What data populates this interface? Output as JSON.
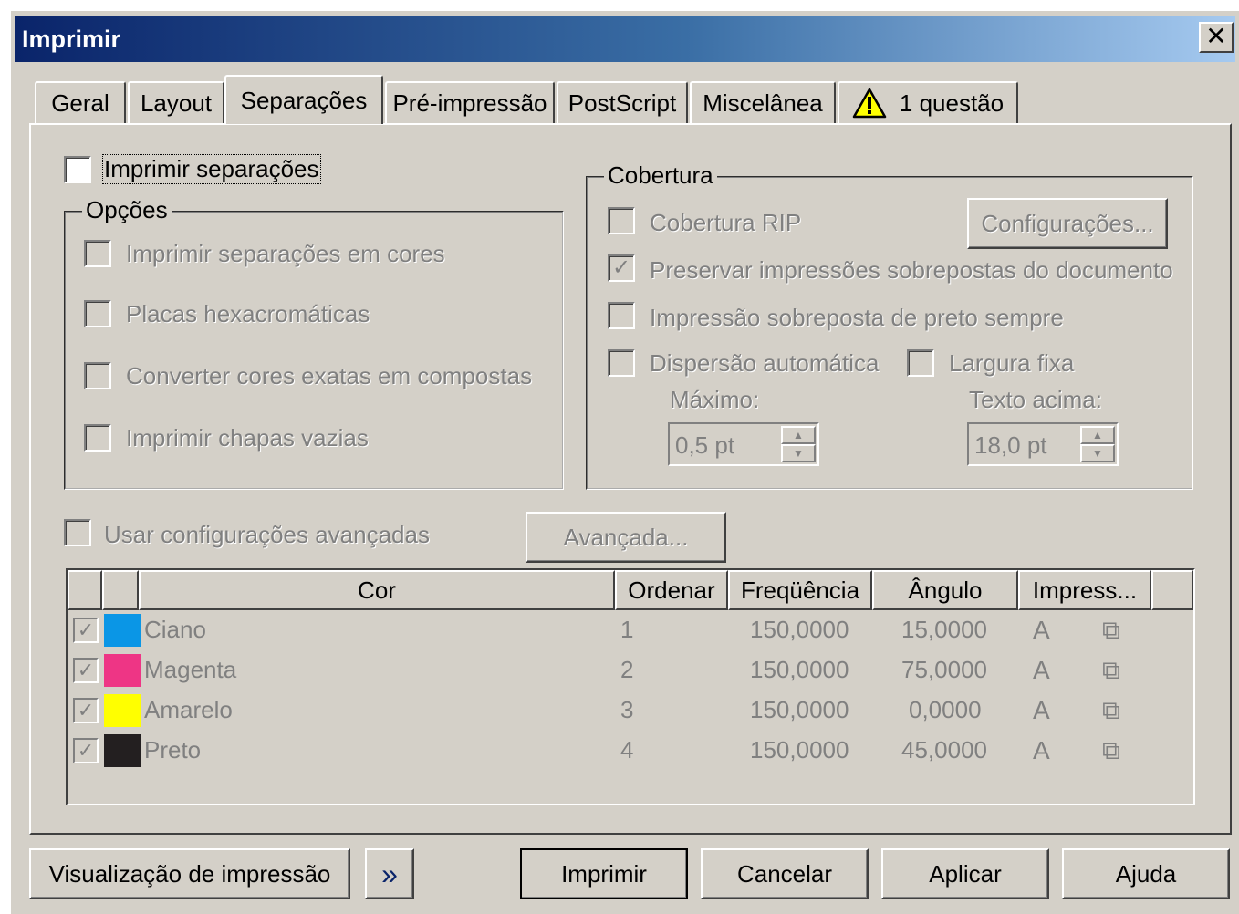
{
  "window": {
    "title": "Imprimir",
    "close_symbol": "✕"
  },
  "tabs": [
    {
      "label": "Geral"
    },
    {
      "label": "Layout"
    },
    {
      "label": "Separações"
    },
    {
      "label": "Pré-impressão"
    },
    {
      "label": "PostScript"
    },
    {
      "label": "Miscelânea"
    },
    {
      "label": "1 questão",
      "icon": "warning-icon"
    }
  ],
  "separations": {
    "print_separations": {
      "label": "Imprimir separações",
      "checked": false
    },
    "options": {
      "legend": "Opções",
      "items": [
        {
          "label": "Imprimir separações em cores"
        },
        {
          "label": "Placas hexacromáticas"
        },
        {
          "label": "Converter cores exatas em compostas"
        },
        {
          "label": "Imprimir chapas vazias"
        }
      ]
    },
    "trapping": {
      "legend": "Cobertura",
      "rip": "Cobertura RIP",
      "settings_button": "Configurações...",
      "preserve": "Preservar impressões sobrepostas do documento",
      "preserve_check": "✓",
      "always_black": "Impressão sobreposta de preto sempre",
      "auto_spread": "Dispersão automática",
      "fixed_width": "Largura fixa",
      "max_label": "Máximo:",
      "max_value": "0,5 pt",
      "text_above_label": "Texto acima:",
      "text_above_value": "18,0 pt"
    },
    "advanced": {
      "label": "Usar configurações avançadas",
      "button": "Avançada..."
    },
    "table": {
      "headers": {
        "cor": "Cor",
        "ordenar": "Ordenar",
        "freq": "Freqüência",
        "angulo": "Ângulo",
        "impress": "Impress..."
      },
      "check_mark": "✓",
      "rows": [
        {
          "name": "Ciano",
          "color": "#0a96e6",
          "order": "1",
          "freq": "150,0000",
          "angle": "15,0000"
        },
        {
          "name": "Magenta",
          "color": "#ee3585",
          "order": "2",
          "freq": "150,0000",
          "angle": "75,0000"
        },
        {
          "name": "Amarelo",
          "color": "#ffff00",
          "order": "3",
          "freq": "150,0000",
          "angle": "0,0000"
        },
        {
          "name": "Preto",
          "color": "#231f20",
          "order": "4",
          "freq": "150,0000",
          "angle": "45,0000"
        }
      ]
    }
  },
  "buttons": {
    "preview": "Visualização de impressão",
    "preview_arrows": "»",
    "print": "Imprimir",
    "cancel": "Cancelar",
    "apply": "Aplicar",
    "help": "Ajuda"
  }
}
